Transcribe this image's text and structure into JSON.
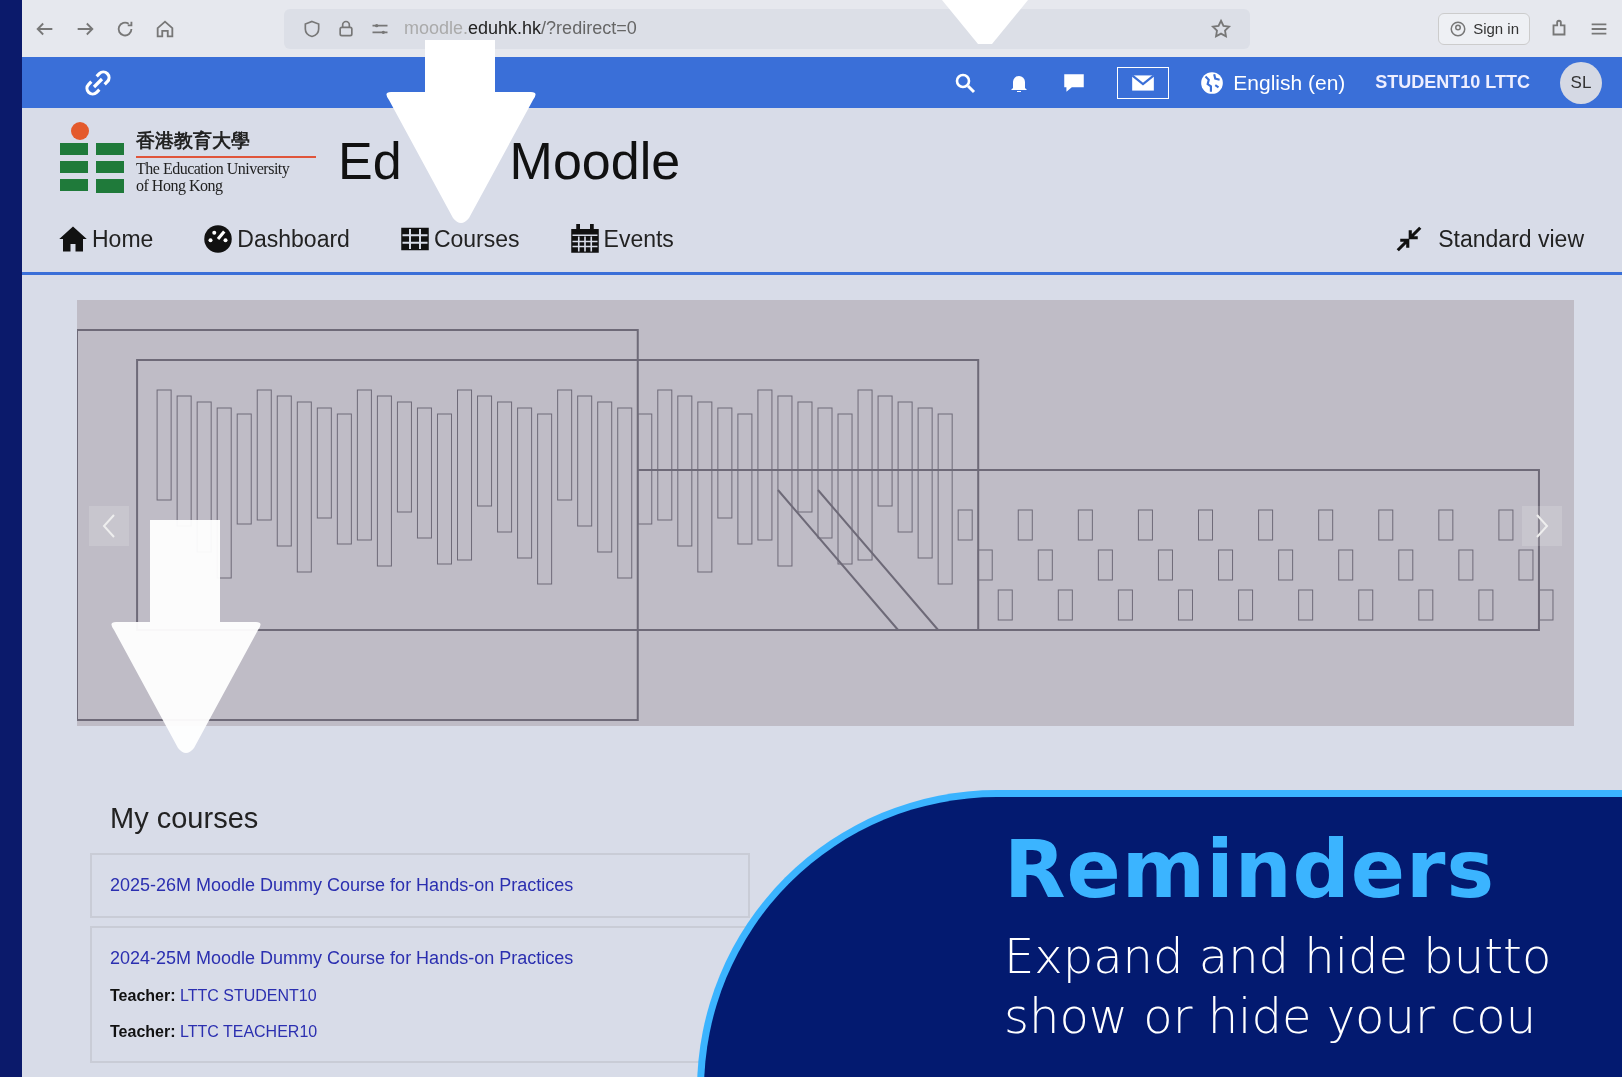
{
  "browser": {
    "url_parts": [
      {
        "kind": "faded",
        "text": "moodle."
      },
      {
        "kind": "host",
        "text": "eduhk.hk"
      },
      {
        "kind": "path",
        "text": "/?redirect=0"
      }
    ],
    "sign_in": "Sign in"
  },
  "topbar": {
    "language": "English (en)",
    "user": "STUDENT10 LTTC",
    "avatar": "SL"
  },
  "logo": {
    "chinese": "香港教育大學",
    "english_lines": [
      "The Education University",
      "of Hong Kong"
    ]
  },
  "site_title_parts": [
    "Ed",
    "Moodle"
  ],
  "nav": [
    {
      "kind": "home",
      "label": "Home"
    },
    {
      "kind": "dashboard",
      "label": "Dashboard"
    },
    {
      "kind": "courses",
      "label": "Courses"
    },
    {
      "kind": "events",
      "label": "Events"
    }
  ],
  "view_toggle": "Standard view",
  "my_courses": {
    "title": "My courses",
    "courses": [
      {
        "title": "2025-26M Moodle Dummy Course for Hands-on Practices"
      },
      {
        "title": "2024-25M Moodle Dummy Course for Hands-on Practices",
        "teachers": [
          {
            "label": "Teacher:",
            "name": "LTTC STUDENT10"
          },
          {
            "label": "Teacher:",
            "name": "LTTC TEACHER10"
          }
        ]
      }
    ]
  },
  "reminders": {
    "title": "Reminders",
    "lines": [
      "Expand and hide butto",
      "show or hide your cou"
    ]
  }
}
